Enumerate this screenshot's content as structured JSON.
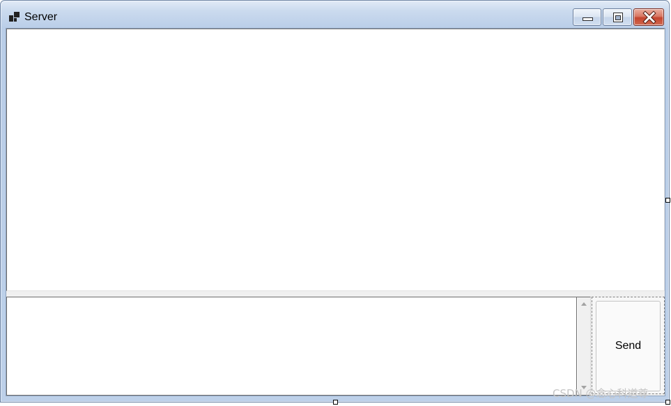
{
  "window": {
    "title": "Server",
    "icon": "app-icon"
  },
  "caption_buttons": {
    "minimize_icon": "minimize-icon",
    "maximize_icon": "maximize-icon",
    "close_icon": "close-icon"
  },
  "form": {
    "output_text": "",
    "input_text": "",
    "send_label": "Send"
  },
  "scrollbar": {
    "up_icon": "scroll-up-arrow-icon",
    "down_icon": "scroll-down-arrow-icon"
  },
  "watermark": {
    "text": "CSDN @念心科道尊"
  },
  "colors": {
    "title_bar": "#bcd0e9",
    "close_button": "#c4432e",
    "form_background": "#f0f0f0",
    "textbox_background": "#ffffff"
  }
}
